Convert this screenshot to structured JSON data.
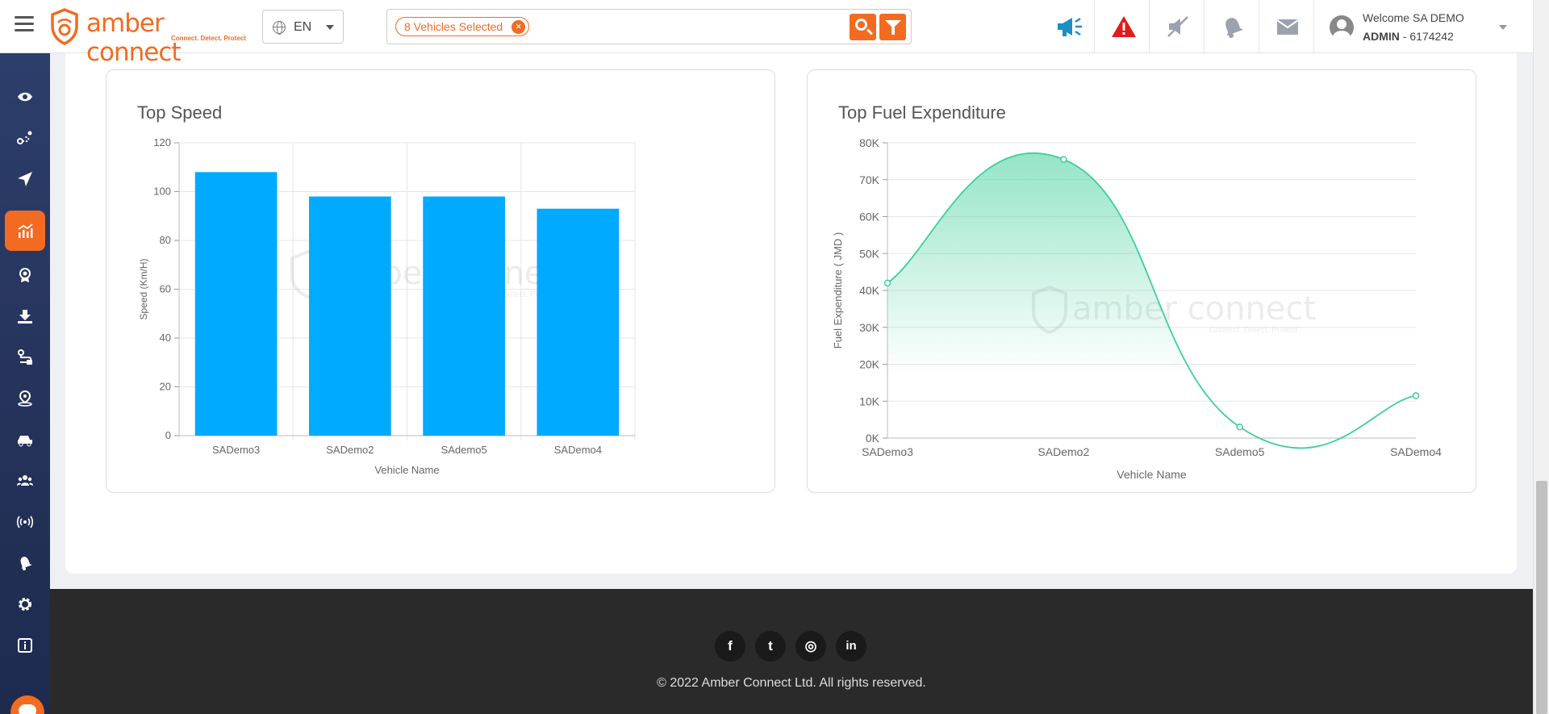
{
  "header": {
    "logo_text": "amber connect",
    "logo_tagline": "Connect. Detect. Protect",
    "language": "EN",
    "search_chip": "8 Vehicles Selected",
    "user_welcome": "Welcome SA DEMO",
    "user_role": "ADMIN",
    "user_id": " - 6174242",
    "icons": [
      "megaphone-icon",
      "alert-icon",
      "mute-icon",
      "bell-icon",
      "mail-icon"
    ],
    "accent_color": "#f26b21"
  },
  "sidebar": {
    "items": [
      {
        "name": "eye-icon"
      },
      {
        "name": "route-icon"
      },
      {
        "name": "navigation-icon"
      },
      {
        "name": "analytics-icon",
        "active": true
      },
      {
        "name": "badge-icon"
      },
      {
        "name": "download-icon"
      },
      {
        "name": "trips-icon"
      },
      {
        "name": "location-pin-icon"
      },
      {
        "name": "vehicle-icon"
      },
      {
        "name": "users-icon"
      },
      {
        "name": "signal-icon"
      },
      {
        "name": "notification-icon"
      },
      {
        "name": "settings-icon"
      },
      {
        "name": "info-icon"
      }
    ]
  },
  "cards": {
    "speed_title": "Top Speed",
    "fuel_title": "Top Fuel Expenditure"
  },
  "chart_data": [
    {
      "type": "bar",
      "title": "Top Speed",
      "categories": [
        "SADemo3",
        "SADemo2",
        "SAdemo5",
        "SADemo4"
      ],
      "values": [
        108,
        98,
        98,
        93
      ],
      "xlabel": "Vehicle Name",
      "ylabel": "Speed (Km/H)",
      "ylim": [
        0,
        120
      ],
      "yticks": [
        0,
        20,
        40,
        60,
        80,
        100,
        120
      ],
      "color": "#00aaff",
      "grid": true
    },
    {
      "type": "area",
      "title": "Top Fuel Expenditure",
      "categories": [
        "SADemo3",
        "SADemo2",
        "SAdemo5",
        "SADemo4"
      ],
      "values": [
        42000,
        75500,
        3000,
        11500
      ],
      "xlabel": "Vehicle Name",
      "ylabel": "Fuel Expenditure ( JMD )",
      "ylim": [
        0,
        80000
      ],
      "yticks": [
        "0K",
        "10K",
        "20K",
        "30K",
        "40K",
        "50K",
        "60K",
        "70K",
        "80K"
      ],
      "color": "#3ecf9a",
      "grid": true
    }
  ],
  "watermark": {
    "text": "amber connect",
    "tagline": "Connect. Detect. Protect"
  },
  "footer": {
    "social": [
      {
        "name": "facebook-icon",
        "glyph": "f"
      },
      {
        "name": "twitter-icon",
        "glyph": "t"
      },
      {
        "name": "instagram-icon",
        "glyph": "◎"
      },
      {
        "name": "linkedin-icon",
        "glyph": "in"
      }
    ],
    "copyright": "© 2022 Amber Connect Ltd. All rights reserved."
  }
}
